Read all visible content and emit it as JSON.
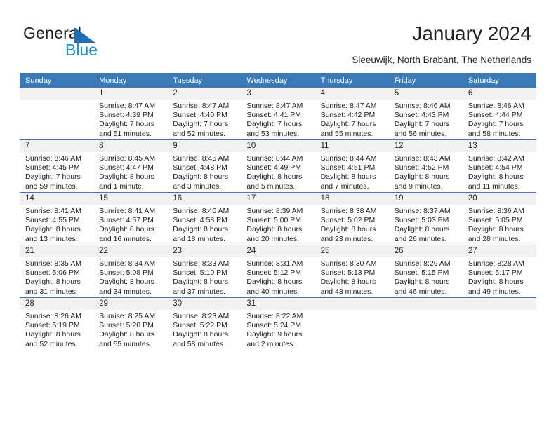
{
  "brand": {
    "name_part1": "General",
    "name_part2": "Blue",
    "triangle_icon": "blue-triangle-icon",
    "colors": {
      "dark_text": "#231f20",
      "blue_light": "#1e8fd5",
      "blue_dark": "#1e6db5",
      "header_bar": "#3a7ab8",
      "daynum_strip": "#f1f1f1"
    }
  },
  "header": {
    "title": "January 2024",
    "subtitle": "Sleeuwijk, North Brabant, The Netherlands"
  },
  "calendar": {
    "weekdays": [
      "Sunday",
      "Monday",
      "Tuesday",
      "Wednesday",
      "Thursday",
      "Friday",
      "Saturday"
    ],
    "weeks": [
      [
        {
          "day": "",
          "empty": true
        },
        {
          "day": "1",
          "sunrise": "Sunrise: 8:47 AM",
          "sunset": "Sunset: 4:39 PM",
          "daylight_line1": "Daylight: 7 hours",
          "daylight_line2": "and 51 minutes."
        },
        {
          "day": "2",
          "sunrise": "Sunrise: 8:47 AM",
          "sunset": "Sunset: 4:40 PM",
          "daylight_line1": "Daylight: 7 hours",
          "daylight_line2": "and 52 minutes."
        },
        {
          "day": "3",
          "sunrise": "Sunrise: 8:47 AM",
          "sunset": "Sunset: 4:41 PM",
          "daylight_line1": "Daylight: 7 hours",
          "daylight_line2": "and 53 minutes."
        },
        {
          "day": "4",
          "sunrise": "Sunrise: 8:47 AM",
          "sunset": "Sunset: 4:42 PM",
          "daylight_line1": "Daylight: 7 hours",
          "daylight_line2": "and 55 minutes."
        },
        {
          "day": "5",
          "sunrise": "Sunrise: 8:46 AM",
          "sunset": "Sunset: 4:43 PM",
          "daylight_line1": "Daylight: 7 hours",
          "daylight_line2": "and 56 minutes."
        },
        {
          "day": "6",
          "sunrise": "Sunrise: 8:46 AM",
          "sunset": "Sunset: 4:44 PM",
          "daylight_line1": "Daylight: 7 hours",
          "daylight_line2": "and 58 minutes."
        }
      ],
      [
        {
          "day": "7",
          "sunrise": "Sunrise: 8:46 AM",
          "sunset": "Sunset: 4:45 PM",
          "daylight_line1": "Daylight: 7 hours",
          "daylight_line2": "and 59 minutes."
        },
        {
          "day": "8",
          "sunrise": "Sunrise: 8:45 AM",
          "sunset": "Sunset: 4:47 PM",
          "daylight_line1": "Daylight: 8 hours",
          "daylight_line2": "and 1 minute."
        },
        {
          "day": "9",
          "sunrise": "Sunrise: 8:45 AM",
          "sunset": "Sunset: 4:48 PM",
          "daylight_line1": "Daylight: 8 hours",
          "daylight_line2": "and 3 minutes."
        },
        {
          "day": "10",
          "sunrise": "Sunrise: 8:44 AM",
          "sunset": "Sunset: 4:49 PM",
          "daylight_line1": "Daylight: 8 hours",
          "daylight_line2": "and 5 minutes."
        },
        {
          "day": "11",
          "sunrise": "Sunrise: 8:44 AM",
          "sunset": "Sunset: 4:51 PM",
          "daylight_line1": "Daylight: 8 hours",
          "daylight_line2": "and 7 minutes."
        },
        {
          "day": "12",
          "sunrise": "Sunrise: 8:43 AM",
          "sunset": "Sunset: 4:52 PM",
          "daylight_line1": "Daylight: 8 hours",
          "daylight_line2": "and 9 minutes."
        },
        {
          "day": "13",
          "sunrise": "Sunrise: 8:42 AM",
          "sunset": "Sunset: 4:54 PM",
          "daylight_line1": "Daylight: 8 hours",
          "daylight_line2": "and 11 minutes."
        }
      ],
      [
        {
          "day": "14",
          "sunrise": "Sunrise: 8:41 AM",
          "sunset": "Sunset: 4:55 PM",
          "daylight_line1": "Daylight: 8 hours",
          "daylight_line2": "and 13 minutes."
        },
        {
          "day": "15",
          "sunrise": "Sunrise: 8:41 AM",
          "sunset": "Sunset: 4:57 PM",
          "daylight_line1": "Daylight: 8 hours",
          "daylight_line2": "and 16 minutes."
        },
        {
          "day": "16",
          "sunrise": "Sunrise: 8:40 AM",
          "sunset": "Sunset: 4:58 PM",
          "daylight_line1": "Daylight: 8 hours",
          "daylight_line2": "and 18 minutes."
        },
        {
          "day": "17",
          "sunrise": "Sunrise: 8:39 AM",
          "sunset": "Sunset: 5:00 PM",
          "daylight_line1": "Daylight: 8 hours",
          "daylight_line2": "and 20 minutes."
        },
        {
          "day": "18",
          "sunrise": "Sunrise: 8:38 AM",
          "sunset": "Sunset: 5:02 PM",
          "daylight_line1": "Daylight: 8 hours",
          "daylight_line2": "and 23 minutes."
        },
        {
          "day": "19",
          "sunrise": "Sunrise: 8:37 AM",
          "sunset": "Sunset: 5:03 PM",
          "daylight_line1": "Daylight: 8 hours",
          "daylight_line2": "and 26 minutes."
        },
        {
          "day": "20",
          "sunrise": "Sunrise: 8:36 AM",
          "sunset": "Sunset: 5:05 PM",
          "daylight_line1": "Daylight: 8 hours",
          "daylight_line2": "and 28 minutes."
        }
      ],
      [
        {
          "day": "21",
          "sunrise": "Sunrise: 8:35 AM",
          "sunset": "Sunset: 5:06 PM",
          "daylight_line1": "Daylight: 8 hours",
          "daylight_line2": "and 31 minutes."
        },
        {
          "day": "22",
          "sunrise": "Sunrise: 8:34 AM",
          "sunset": "Sunset: 5:08 PM",
          "daylight_line1": "Daylight: 8 hours",
          "daylight_line2": "and 34 minutes."
        },
        {
          "day": "23",
          "sunrise": "Sunrise: 8:33 AM",
          "sunset": "Sunset: 5:10 PM",
          "daylight_line1": "Daylight: 8 hours",
          "daylight_line2": "and 37 minutes."
        },
        {
          "day": "24",
          "sunrise": "Sunrise: 8:31 AM",
          "sunset": "Sunset: 5:12 PM",
          "daylight_line1": "Daylight: 8 hours",
          "daylight_line2": "and 40 minutes."
        },
        {
          "day": "25",
          "sunrise": "Sunrise: 8:30 AM",
          "sunset": "Sunset: 5:13 PM",
          "daylight_line1": "Daylight: 8 hours",
          "daylight_line2": "and 43 minutes."
        },
        {
          "day": "26",
          "sunrise": "Sunrise: 8:29 AM",
          "sunset": "Sunset: 5:15 PM",
          "daylight_line1": "Daylight: 8 hours",
          "daylight_line2": "and 46 minutes."
        },
        {
          "day": "27",
          "sunrise": "Sunrise: 8:28 AM",
          "sunset": "Sunset: 5:17 PM",
          "daylight_line1": "Daylight: 8 hours",
          "daylight_line2": "and 49 minutes."
        }
      ],
      [
        {
          "day": "28",
          "sunrise": "Sunrise: 8:26 AM",
          "sunset": "Sunset: 5:19 PM",
          "daylight_line1": "Daylight: 8 hours",
          "daylight_line2": "and 52 minutes."
        },
        {
          "day": "29",
          "sunrise": "Sunrise: 8:25 AM",
          "sunset": "Sunset: 5:20 PM",
          "daylight_line1": "Daylight: 8 hours",
          "daylight_line2": "and 55 minutes."
        },
        {
          "day": "30",
          "sunrise": "Sunrise: 8:23 AM",
          "sunset": "Sunset: 5:22 PM",
          "daylight_line1": "Daylight: 8 hours",
          "daylight_line2": "and 58 minutes."
        },
        {
          "day": "31",
          "sunrise": "Sunrise: 8:22 AM",
          "sunset": "Sunset: 5:24 PM",
          "daylight_line1": "Daylight: 9 hours",
          "daylight_line2": "and 2 minutes."
        },
        {
          "day": "",
          "empty": true
        },
        {
          "day": "",
          "empty": true
        },
        {
          "day": "",
          "empty": true
        }
      ]
    ]
  }
}
